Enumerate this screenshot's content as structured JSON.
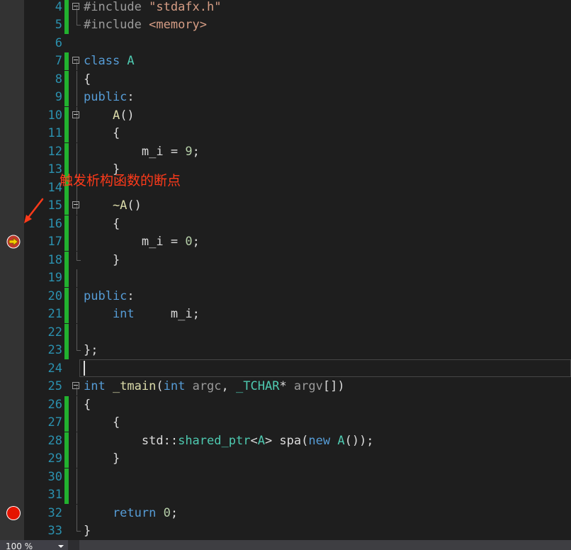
{
  "editor": {
    "lines": [
      {
        "n": "4",
        "tokens": [
          {
            "t": "#include ",
            "c": "pp"
          },
          {
            "t": "\"stdafx.h\"",
            "c": "str"
          }
        ]
      },
      {
        "n": "5",
        "tokens": [
          {
            "t": "#include ",
            "c": "pp"
          },
          {
            "t": "<memory>",
            "c": "str"
          }
        ]
      },
      {
        "n": "6",
        "tokens": []
      },
      {
        "n": "7",
        "tokens": [
          {
            "t": "class ",
            "c": "kw"
          },
          {
            "t": "A",
            "c": "typ"
          }
        ]
      },
      {
        "n": "8",
        "tokens": [
          {
            "t": "{",
            "c": ""
          }
        ]
      },
      {
        "n": "9",
        "tokens": [
          {
            "t": "public",
            "c": "kw"
          },
          {
            "t": ":",
            "c": ""
          }
        ]
      },
      {
        "n": "10",
        "tokens": [
          {
            "t": "    A",
            "c": "fn"
          },
          {
            "t": "()",
            "c": ""
          }
        ]
      },
      {
        "n": "11",
        "tokens": [
          {
            "t": "    {",
            "c": ""
          }
        ]
      },
      {
        "n": "12",
        "tokens": [
          {
            "t": "        m_i",
            "c": "var"
          },
          {
            "t": " = ",
            "c": ""
          },
          {
            "t": "9",
            "c": "num"
          },
          {
            "t": ";",
            "c": ""
          }
        ]
      },
      {
        "n": "13",
        "tokens": [
          {
            "t": "    }",
            "c": ""
          }
        ]
      },
      {
        "n": "14",
        "tokens": []
      },
      {
        "n": "15",
        "tokens": [
          {
            "t": "    ~A",
            "c": "fn"
          },
          {
            "t": "()",
            "c": ""
          }
        ]
      },
      {
        "n": "16",
        "tokens": [
          {
            "t": "    {",
            "c": ""
          }
        ]
      },
      {
        "n": "17",
        "tokens": [
          {
            "t": "        m_i",
            "c": "var"
          },
          {
            "t": " = ",
            "c": ""
          },
          {
            "t": "0",
            "c": "num"
          },
          {
            "t": ";",
            "c": ""
          }
        ]
      },
      {
        "n": "18",
        "tokens": [
          {
            "t": "    }",
            "c": ""
          }
        ]
      },
      {
        "n": "19",
        "tokens": []
      },
      {
        "n": "20",
        "tokens": [
          {
            "t": "public",
            "c": "kw"
          },
          {
            "t": ":",
            "c": ""
          }
        ]
      },
      {
        "n": "21",
        "tokens": [
          {
            "t": "    int",
            "c": "kw"
          },
          {
            "t": "     ",
            "c": ""
          },
          {
            "t": "m_i",
            "c": "var"
          },
          {
            "t": ";",
            "c": ""
          }
        ]
      },
      {
        "n": "22",
        "tokens": []
      },
      {
        "n": "23",
        "tokens": [
          {
            "t": "};",
            "c": ""
          }
        ]
      },
      {
        "n": "24",
        "tokens": []
      },
      {
        "n": "25",
        "tokens": [
          {
            "t": "int ",
            "c": "kw"
          },
          {
            "t": "_tmain",
            "c": "fn"
          },
          {
            "t": "(",
            "c": ""
          },
          {
            "t": "int ",
            "c": "kw"
          },
          {
            "t": "argc",
            "c": "prm"
          },
          {
            "t": ", ",
            "c": ""
          },
          {
            "t": "_TCHAR",
            "c": "typ"
          },
          {
            "t": "* ",
            "c": ""
          },
          {
            "t": "argv",
            "c": "prm"
          },
          {
            "t": "[])",
            "c": ""
          }
        ]
      },
      {
        "n": "26",
        "tokens": [
          {
            "t": "{",
            "c": ""
          }
        ]
      },
      {
        "n": "27",
        "tokens": [
          {
            "t": "    {",
            "c": ""
          }
        ]
      },
      {
        "n": "28",
        "tokens": [
          {
            "t": "        std",
            "c": ""
          },
          {
            "t": "::",
            "c": ""
          },
          {
            "t": "shared_ptr",
            "c": "typ"
          },
          {
            "t": "<",
            "c": ""
          },
          {
            "t": "A",
            "c": "typ"
          },
          {
            "t": "> ",
            "c": ""
          },
          {
            "t": "spa",
            "c": ""
          },
          {
            "t": "(",
            "c": ""
          },
          {
            "t": "new ",
            "c": "kw"
          },
          {
            "t": "A",
            "c": "typ"
          },
          {
            "t": "());",
            "c": ""
          }
        ]
      },
      {
        "n": "29",
        "tokens": [
          {
            "t": "    }",
            "c": ""
          }
        ]
      },
      {
        "n": "30",
        "tokens": []
      },
      {
        "n": "31",
        "tokens": []
      },
      {
        "n": "32",
        "tokens": [
          {
            "t": "    return ",
            "c": "kw"
          },
          {
            "t": "0",
            "c": "num"
          },
          {
            "t": ";",
            "c": ""
          }
        ]
      },
      {
        "n": "33",
        "tokens": [
          {
            "t": "}",
            "c": ""
          }
        ]
      }
    ]
  },
  "annotation": {
    "text": "触发析构函数的断点",
    "color": "#ff3a1a"
  },
  "icons": {
    "next_statement": "next-statement-arrow-icon",
    "breakpoint": "breakpoint-icon",
    "arrow": "annotation-arrow-icon"
  },
  "status": {
    "zoom": "100 %"
  },
  "colors": {
    "keyword": "#569cd6",
    "string": "#d69d85",
    "number": "#b5cea8",
    "type": "#4ec9b0",
    "function": "#dcdcaa",
    "line_number": "#2b91af",
    "change_bar": "#22b12e",
    "breakpoint": "#e51400"
  }
}
